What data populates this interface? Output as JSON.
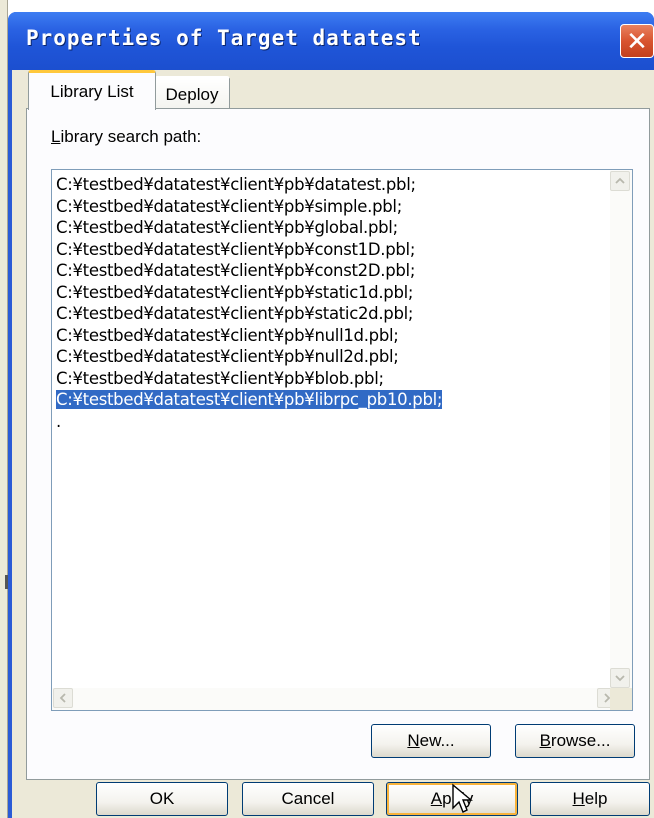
{
  "window": {
    "title": "Properties of Target datatest",
    "close_glyph": "✕"
  },
  "tabs": [
    {
      "label": "Library List",
      "active": true
    },
    {
      "label": "Deploy",
      "active": false
    }
  ],
  "panel": {
    "search_label_access": "L",
    "search_label_rest": "ibrary search path:",
    "paths": [
      "C:¥testbed¥datatest¥client¥pb¥datatest.pbl;",
      "C:¥testbed¥datatest¥client¥pb¥simple.pbl;",
      "C:¥testbed¥datatest¥client¥pb¥global.pbl;",
      "C:¥testbed¥datatest¥client¥pb¥const1D.pbl;",
      "C:¥testbed¥datatest¥client¥pb¥const2D.pbl;",
      "C:¥testbed¥datatest¥client¥pb¥static1d.pbl;",
      "C:¥testbed¥datatest¥client¥pb¥static2d.pbl;",
      "C:¥testbed¥datatest¥client¥pb¥null1d.pbl;",
      "C:¥testbed¥datatest¥client¥pb¥null2d.pbl;",
      "C:¥testbed¥datatest¥client¥pb¥blob.pbl;",
      "C:¥testbed¥datatest¥client¥pb¥librpc_pb10.pbl;"
    ],
    "selected_index": 10,
    "trailing_line": ".",
    "new_button": {
      "access": "N",
      "rest": "ew..."
    },
    "browse_button": {
      "access": "B",
      "rest": "rowse..."
    }
  },
  "footer": {
    "ok": "OK",
    "cancel": "Cancel",
    "apply": {
      "access": "A",
      "rest": "pply"
    },
    "help": {
      "access": "H",
      "rest": "elp"
    }
  },
  "icons": {
    "scroll_up": "up-arrow",
    "scroll_down": "down-arrow",
    "scroll_left": "left-arrow",
    "scroll_right": "right-arrow"
  },
  "colors": {
    "title_bar": "#2a62e3",
    "selection": "#316ac5",
    "default_button_focus": "#f8b33b",
    "close_button": "#d9542f"
  }
}
